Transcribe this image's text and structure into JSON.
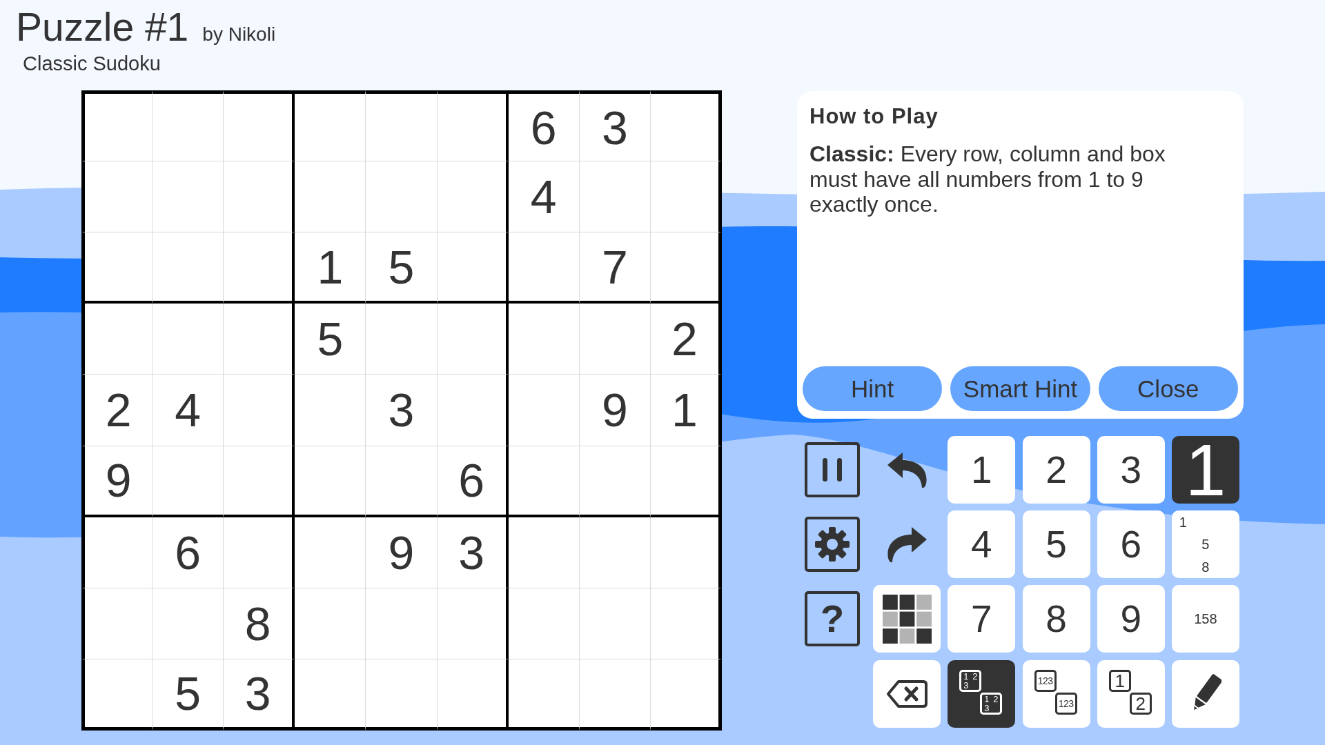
{
  "header": {
    "title": "Puzzle #1",
    "author": "by Nikoli",
    "subtitle": "Classic Sudoku"
  },
  "grid": {
    "rows": [
      [
        null,
        null,
        null,
        null,
        null,
        null,
        "6",
        "3",
        null
      ],
      [
        null,
        null,
        null,
        null,
        null,
        null,
        "4",
        null,
        null
      ],
      [
        null,
        null,
        null,
        "1",
        "5",
        null,
        null,
        "7",
        null
      ],
      [
        null,
        null,
        null,
        "5",
        null,
        null,
        null,
        null,
        "2"
      ],
      [
        "2",
        "4",
        null,
        null,
        "3",
        null,
        null,
        "9",
        "1"
      ],
      [
        "9",
        null,
        null,
        null,
        null,
        "6",
        null,
        null,
        null
      ],
      [
        null,
        "6",
        null,
        null,
        "9",
        "3",
        null,
        null,
        null
      ],
      [
        null,
        null,
        "8",
        null,
        null,
        null,
        null,
        null,
        null
      ],
      [
        null,
        "5",
        "3",
        null,
        null,
        null,
        null,
        null,
        null
      ]
    ]
  },
  "how_to_play": {
    "title": "How to Play",
    "text": "**Classic:** Every row, column and box must have all numbers from 1 to 9 exactly once.",
    "buttons": [
      "Hint",
      "Smart Hint",
      "Close"
    ]
  },
  "controls": {
    "side_buttons": [
      {
        "kind": "pause"
      },
      {
        "kind": "settings"
      },
      {
        "kind": "help",
        "label": "?"
      }
    ],
    "history": [
      {
        "kind": "undo"
      },
      {
        "kind": "redo"
      }
    ],
    "number_keys": [
      "1",
      "2",
      "3",
      "4",
      "5",
      "6",
      "7",
      "8",
      "9"
    ],
    "entry_modes": [
      {
        "kind": "normal",
        "label": "1",
        "selected": true
      },
      {
        "kind": "corner",
        "selected": false,
        "marks": [
          "1",
          "5",
          "8"
        ]
      },
      {
        "kind": "center",
        "label": "158",
        "selected": false
      }
    ],
    "note_layouts": [
      {
        "kind": "corner",
        "selected": true,
        "cells": [
          {
            "marks": [
              "1",
              "2",
              "3"
            ]
          },
          {
            "marks": [
              "1",
              "2",
              "3"
            ]
          }
        ]
      },
      {
        "kind": "center",
        "selected": false,
        "cells": [
          {
            "text": "123"
          },
          {
            "text": "123"
          }
        ]
      },
      {
        "kind": "single",
        "selected": false,
        "cells": [
          {
            "text": "1"
          },
          {
            "text": "2"
          }
        ]
      }
    ]
  }
}
